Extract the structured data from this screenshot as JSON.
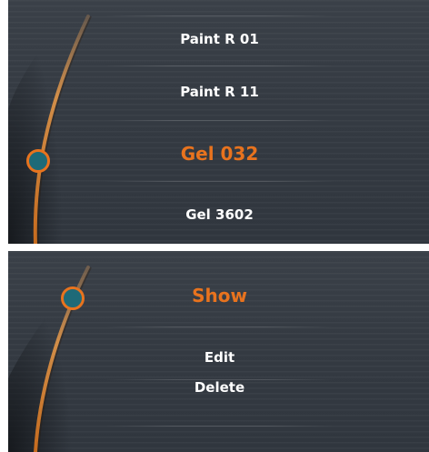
{
  "top_menu": {
    "items": [
      {
        "label": "Paint R 01",
        "selected": false
      },
      {
        "label": "Paint R 11",
        "selected": false
      },
      {
        "label": "Gel 032",
        "selected": true
      },
      {
        "label": "Gel 3602",
        "selected": false
      }
    ]
  },
  "bottom_menu": {
    "items": [
      {
        "label": "Show",
        "selected": true
      },
      {
        "label": "Edit",
        "selected": false
      },
      {
        "label": "Delete",
        "selected": false
      }
    ]
  },
  "colors": {
    "accent": "#e8731e",
    "knob_fill": "#1e6a78",
    "panel_bg": "#363c44",
    "text": "#ffffff"
  },
  "icons": {
    "arc": "curved-track-icon",
    "knob": "selector-knob-icon"
  }
}
